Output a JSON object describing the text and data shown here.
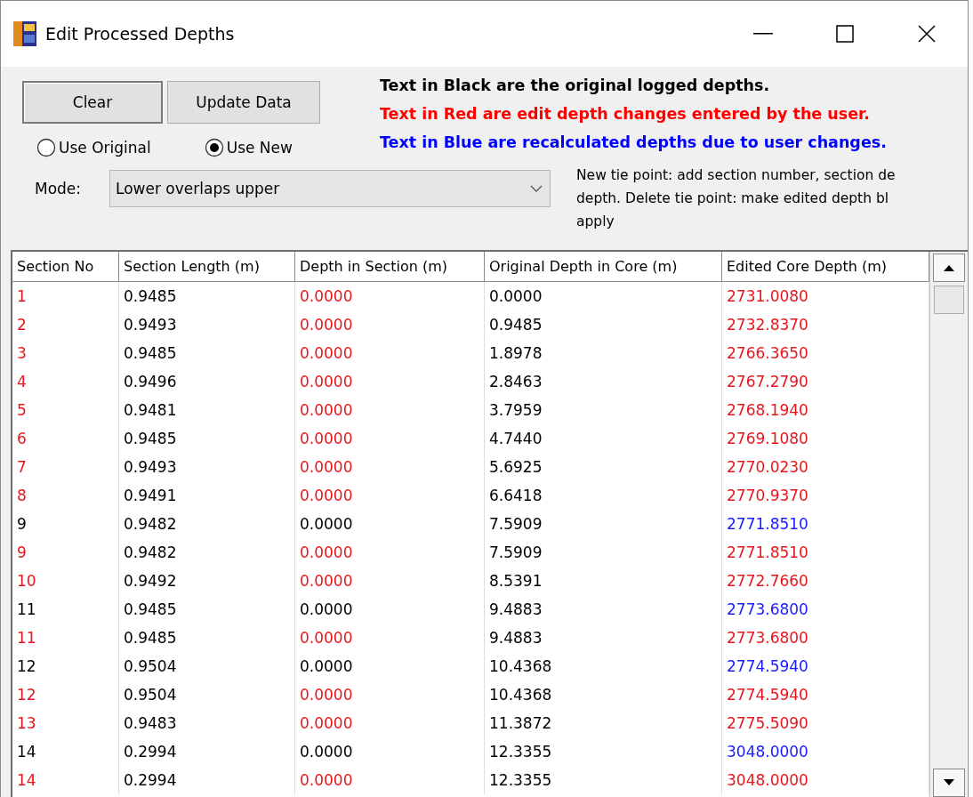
{
  "window": {
    "title": "Edit Processed Depths"
  },
  "buttons": [
    {
      "label": "Clear",
      "pressed": true
    },
    {
      "label": "Update Data",
      "pressed": false
    }
  ],
  "radios": [
    {
      "label": "Use Original",
      "selected": false
    },
    {
      "label": "Use New",
      "selected": true
    }
  ],
  "mode": {
    "label": "Mode:",
    "value": "Lower overlaps upper"
  },
  "legend": [
    {
      "text": "Text in Black are the original logged depths.",
      "color": "#000000"
    },
    {
      "text": "Text in Red are edit depth changes entered by the user.",
      "color": "#ff0000"
    },
    {
      "text": "Text in Blue are recalculated depths due to user changes.",
      "color": "#0000ff"
    }
  ],
  "note_lines": [
    "New tie point: add section number, section de",
    "depth.  Delete tie point: make edited depth bl",
    "apply"
  ],
  "table": {
    "columns": [
      "Section No",
      "Section Length (m)",
      "Depth in Section (m)",
      "Original Depth in Core (m)",
      "Edited Core Depth (m)"
    ],
    "rows": [
      {
        "cells": [
          {
            "text": "1",
            "color": "#e8161c"
          },
          {
            "text": "0.9485",
            "color": "#000000"
          },
          {
            "text": "0.0000",
            "color": "#e8161c"
          },
          {
            "text": "0.0000",
            "color": "#000000"
          },
          {
            "text": "2731.0080",
            "color": "#e8161c"
          }
        ]
      },
      {
        "cells": [
          {
            "text": "2",
            "color": "#e8161c"
          },
          {
            "text": "0.9493",
            "color": "#000000"
          },
          {
            "text": "0.0000",
            "color": "#e8161c"
          },
          {
            "text": "0.9485",
            "color": "#000000"
          },
          {
            "text": "2732.8370",
            "color": "#e8161c"
          }
        ]
      },
      {
        "cells": [
          {
            "text": "3",
            "color": "#e8161c"
          },
          {
            "text": "0.9485",
            "color": "#000000"
          },
          {
            "text": "0.0000",
            "color": "#e8161c"
          },
          {
            "text": "1.8978",
            "color": "#000000"
          },
          {
            "text": "2766.3650",
            "color": "#e8161c"
          }
        ]
      },
      {
        "cells": [
          {
            "text": "4",
            "color": "#e8161c"
          },
          {
            "text": "0.9496",
            "color": "#000000"
          },
          {
            "text": "0.0000",
            "color": "#e8161c"
          },
          {
            "text": "2.8463",
            "color": "#000000"
          },
          {
            "text": "2767.2790",
            "color": "#e8161c"
          }
        ]
      },
      {
        "cells": [
          {
            "text": "5",
            "color": "#e8161c"
          },
          {
            "text": "0.9481",
            "color": "#000000"
          },
          {
            "text": "0.0000",
            "color": "#e8161c"
          },
          {
            "text": "3.7959",
            "color": "#000000"
          },
          {
            "text": "2768.1940",
            "color": "#e8161c"
          }
        ]
      },
      {
        "cells": [
          {
            "text": "6",
            "color": "#e8161c"
          },
          {
            "text": "0.9485",
            "color": "#000000"
          },
          {
            "text": "0.0000",
            "color": "#e8161c"
          },
          {
            "text": "4.7440",
            "color": "#000000"
          },
          {
            "text": "2769.1080",
            "color": "#e8161c"
          }
        ]
      },
      {
        "cells": [
          {
            "text": "7",
            "color": "#e8161c"
          },
          {
            "text": "0.9493",
            "color": "#000000"
          },
          {
            "text": "0.0000",
            "color": "#e8161c"
          },
          {
            "text": "5.6925",
            "color": "#000000"
          },
          {
            "text": "2770.0230",
            "color": "#e8161c"
          }
        ]
      },
      {
        "cells": [
          {
            "text": "8",
            "color": "#e8161c"
          },
          {
            "text": "0.9491",
            "color": "#000000"
          },
          {
            "text": "0.0000",
            "color": "#e8161c"
          },
          {
            "text": "6.6418",
            "color": "#000000"
          },
          {
            "text": "2770.9370",
            "color": "#e8161c"
          }
        ]
      },
      {
        "cells": [
          {
            "text": "9",
            "color": "#000000"
          },
          {
            "text": "0.9482",
            "color": "#000000"
          },
          {
            "text": "0.0000",
            "color": "#000000"
          },
          {
            "text": "7.5909",
            "color": "#000000"
          },
          {
            "text": "2771.8510",
            "color": "#1a1aff"
          }
        ]
      },
      {
        "cells": [
          {
            "text": "9",
            "color": "#e8161c"
          },
          {
            "text": "0.9482",
            "color": "#000000"
          },
          {
            "text": "0.0000",
            "color": "#e8161c"
          },
          {
            "text": "7.5909",
            "color": "#000000"
          },
          {
            "text": "2771.8510",
            "color": "#e8161c"
          }
        ]
      },
      {
        "cells": [
          {
            "text": "10",
            "color": "#e8161c"
          },
          {
            "text": "0.9492",
            "color": "#000000"
          },
          {
            "text": "0.0000",
            "color": "#e8161c"
          },
          {
            "text": "8.5391",
            "color": "#000000"
          },
          {
            "text": "2772.7660",
            "color": "#e8161c"
          }
        ]
      },
      {
        "cells": [
          {
            "text": "11",
            "color": "#000000"
          },
          {
            "text": "0.9485",
            "color": "#000000"
          },
          {
            "text": "0.0000",
            "color": "#000000"
          },
          {
            "text": "9.4883",
            "color": "#000000"
          },
          {
            "text": "2773.6800",
            "color": "#1a1aff"
          }
        ]
      },
      {
        "cells": [
          {
            "text": "11",
            "color": "#e8161c"
          },
          {
            "text": "0.9485",
            "color": "#000000"
          },
          {
            "text": "0.0000",
            "color": "#e8161c"
          },
          {
            "text": "9.4883",
            "color": "#000000"
          },
          {
            "text": "2773.6800",
            "color": "#e8161c"
          }
        ]
      },
      {
        "cells": [
          {
            "text": "12",
            "color": "#000000"
          },
          {
            "text": "0.9504",
            "color": "#000000"
          },
          {
            "text": "0.0000",
            "color": "#000000"
          },
          {
            "text": "10.4368",
            "color": "#000000"
          },
          {
            "text": "2774.5940",
            "color": "#1a1aff"
          }
        ]
      },
      {
        "cells": [
          {
            "text": "12",
            "color": "#e8161c"
          },
          {
            "text": "0.9504",
            "color": "#000000"
          },
          {
            "text": "0.0000",
            "color": "#e8161c"
          },
          {
            "text": "10.4368",
            "color": "#000000"
          },
          {
            "text": "2774.5940",
            "color": "#e8161c"
          }
        ]
      },
      {
        "cells": [
          {
            "text": "13",
            "color": "#e8161c"
          },
          {
            "text": "0.9483",
            "color": "#000000"
          },
          {
            "text": "0.0000",
            "color": "#e8161c"
          },
          {
            "text": "11.3872",
            "color": "#000000"
          },
          {
            "text": "2775.5090",
            "color": "#e8161c"
          }
        ]
      },
      {
        "cells": [
          {
            "text": "14",
            "color": "#000000"
          },
          {
            "text": "0.2994",
            "color": "#000000"
          },
          {
            "text": "0.0000",
            "color": "#000000"
          },
          {
            "text": "12.3355",
            "color": "#000000"
          },
          {
            "text": "3048.0000",
            "color": "#1a1aff"
          }
        ]
      },
      {
        "cells": [
          {
            "text": "14",
            "color": "#e8161c"
          },
          {
            "text": "0.2994",
            "color": "#000000"
          },
          {
            "text": "0.0000",
            "color": "#e8161c"
          },
          {
            "text": "12.3355",
            "color": "#000000"
          },
          {
            "text": "3048.0000",
            "color": "#e8161c"
          }
        ]
      }
    ]
  }
}
